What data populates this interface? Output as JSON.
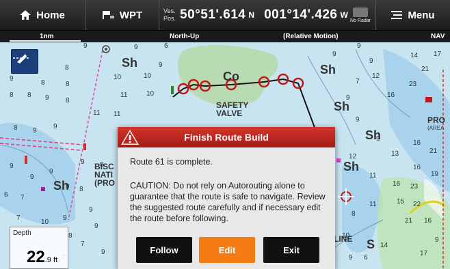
{
  "topbar": {
    "home_label": "Home",
    "wpt_label": "WPT",
    "pos_label_line1": "Ves.",
    "pos_label_line2": "Pos.",
    "latitude": "50°51'.614",
    "lat_hemi": "N",
    "longitude": "001°14'.426",
    "lon_hemi": "W",
    "radar_status": "No Radar",
    "menu_label": "Menu"
  },
  "status_strip": {
    "scale": "1nm",
    "orientation": "North-Up",
    "motion": "(Relative Motion)",
    "mode": "NAV"
  },
  "chart": {
    "labels": {
      "safety_valve_1": "SAFETY",
      "safety_valve_2": "VALVE",
      "co": "Co",
      "bisc": "BISC",
      "nati": "NATI",
      "pro": "(PRO",
      "pro_right": "PRO",
      "area": "(AREA",
      "line": "LINE"
    }
  },
  "depth": {
    "label": "Depth",
    "value": "22",
    "decimal": ".9",
    "unit": "ft"
  },
  "dialog": {
    "title": "Finish Route Build",
    "line1": "Route 61 is complete.",
    "caution": "CAUTION: Do not rely on Autorouting alone to guarantee that the route is safe to navigate. Review the suggested route carefully and if necessary edit the route before following.",
    "follow_label": "Follow",
    "edit_label": "Edit",
    "exit_label": "Exit"
  },
  "colors": {
    "dialog_header": "#c0281f",
    "edit_button": "#f57c12",
    "topbar": "#262626",
    "water": "#c9e4f1",
    "land": "#e8d7a0"
  }
}
